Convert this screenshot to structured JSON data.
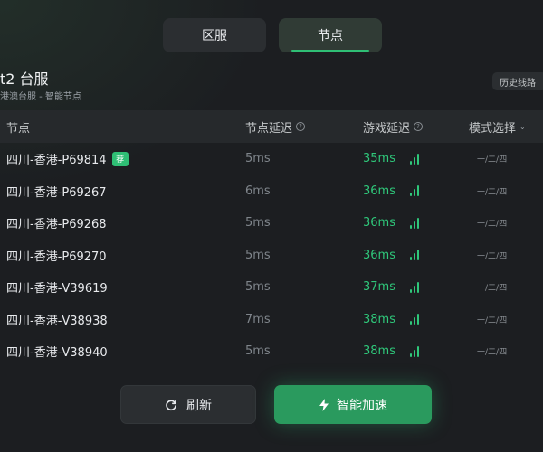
{
  "tabs": [
    {
      "label": "区服",
      "active": false
    },
    {
      "label": "节点",
      "active": true
    }
  ],
  "server": {
    "title": "t2 台服",
    "subtitle": "港澳台服 - 智能节点",
    "history_label": "历史线路"
  },
  "table": {
    "headers": {
      "node": "节点",
      "node_latency": "节点延迟",
      "game_latency": "游戏延迟",
      "mode": "模式选择"
    },
    "rows": [
      {
        "name": "四川-香港-P69814",
        "recommended": true,
        "badge": "荐",
        "node_latency": "5ms",
        "game_latency": "35ms",
        "mode": "一/二/四"
      },
      {
        "name": "四川-香港-P69267",
        "recommended": false,
        "badge": "",
        "node_latency": "6ms",
        "game_latency": "36ms",
        "mode": "一/二/四"
      },
      {
        "name": "四川-香港-P69268",
        "recommended": false,
        "badge": "",
        "node_latency": "5ms",
        "game_latency": "36ms",
        "mode": "一/二/四"
      },
      {
        "name": "四川-香港-P69270",
        "recommended": false,
        "badge": "",
        "node_latency": "5ms",
        "game_latency": "36ms",
        "mode": "一/二/四"
      },
      {
        "name": "四川-香港-V39619",
        "recommended": false,
        "badge": "",
        "node_latency": "5ms",
        "game_latency": "37ms",
        "mode": "一/二/四"
      },
      {
        "name": "四川-香港-V38938",
        "recommended": false,
        "badge": "",
        "node_latency": "7ms",
        "game_latency": "38ms",
        "mode": "一/二/四"
      },
      {
        "name": "四川-香港-V38940",
        "recommended": false,
        "badge": "",
        "node_latency": "5ms",
        "game_latency": "38ms",
        "mode": "一/二/四"
      }
    ]
  },
  "buttons": {
    "refresh_label": "刷新",
    "accelerate_label": "智能加速"
  },
  "colors": {
    "accent_green": "#2fbf75",
    "latency_green": "#2fc77a",
    "background": "#1c1e21"
  },
  "icons": {
    "refresh": "refresh-icon",
    "accelerate": "lightning-icon",
    "signal": "signal-bars-icon",
    "help": "question-circle-icon",
    "dropdown": "chevron-down-icon"
  }
}
